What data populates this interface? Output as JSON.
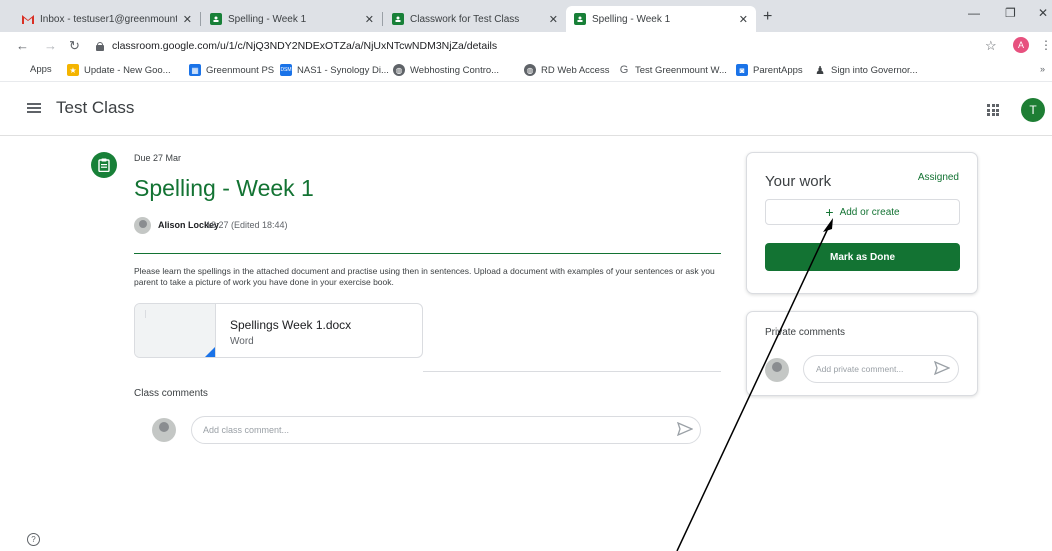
{
  "browser": {
    "tabs": [
      {
        "title": "Inbox - testuser1@greenmount.",
        "icon": "gmail-icon",
        "color": "#d93025"
      },
      {
        "title": "Spelling - Week 1",
        "icon": "classroom-icon",
        "color": "#188038"
      },
      {
        "title": "Classwork for Test Class",
        "icon": "classroom-icon",
        "color": "#188038"
      },
      {
        "title": "Spelling - Week 1",
        "icon": "classroom-icon",
        "color": "#188038",
        "active": true
      }
    ],
    "url": "classroom.google.com/u/1/c/NjQ3NDY2NDExOTZa/a/NjUxNTcwNDM3NjZa/details",
    "profile_initial": "A",
    "bookmarks": [
      {
        "label": "Apps",
        "icon": "apps-grid-icon"
      },
      {
        "label": "Update - New Goo...",
        "icon": "folder-star-icon"
      },
      {
        "label": "Greenmount PS",
        "icon": "calendar-icon"
      },
      {
        "label": "NAS1 - Synology Di...",
        "icon": "synology-icon"
      },
      {
        "label": "Webhosting Contro...",
        "icon": "globe-icon"
      },
      {
        "label": "RD Web Access",
        "icon": "globe-icon"
      },
      {
        "label": "Test Greenmount W...",
        "icon": "google-g-icon"
      },
      {
        "label": "ParentApps",
        "icon": "parentapps-icon"
      },
      {
        "label": "Sign into Governor...",
        "icon": "governor-icon"
      }
    ],
    "bookmarks_more": "»"
  },
  "classroom": {
    "class_name": "Test Class",
    "user_initial": "T"
  },
  "assignment": {
    "due": "Due 27 Mar",
    "title": "Spelling - Week 1",
    "author": "Alison Lockey",
    "posted": "18:27 (Edited 18:44)",
    "description": "Please learn the spellings in the attached document and practise using then in sentences. Upload a document with examples of your sentences or ask you parent to take a picture of work you have done in your exercise book.",
    "attachment": {
      "name": "Spellings Week 1.docx",
      "type": "Word"
    },
    "class_comments_title": "Class comments",
    "class_comment_placeholder": "Add class comment..."
  },
  "your_work": {
    "title": "Your work",
    "status": "Assigned",
    "add_label": "Add or create",
    "done_label": "Mark as Done"
  },
  "private_comments": {
    "title": "Private comments",
    "placeholder": "Add private comment..."
  },
  "colors": {
    "classroom_green": "#137333",
    "annotation_arrow": "#000000"
  }
}
